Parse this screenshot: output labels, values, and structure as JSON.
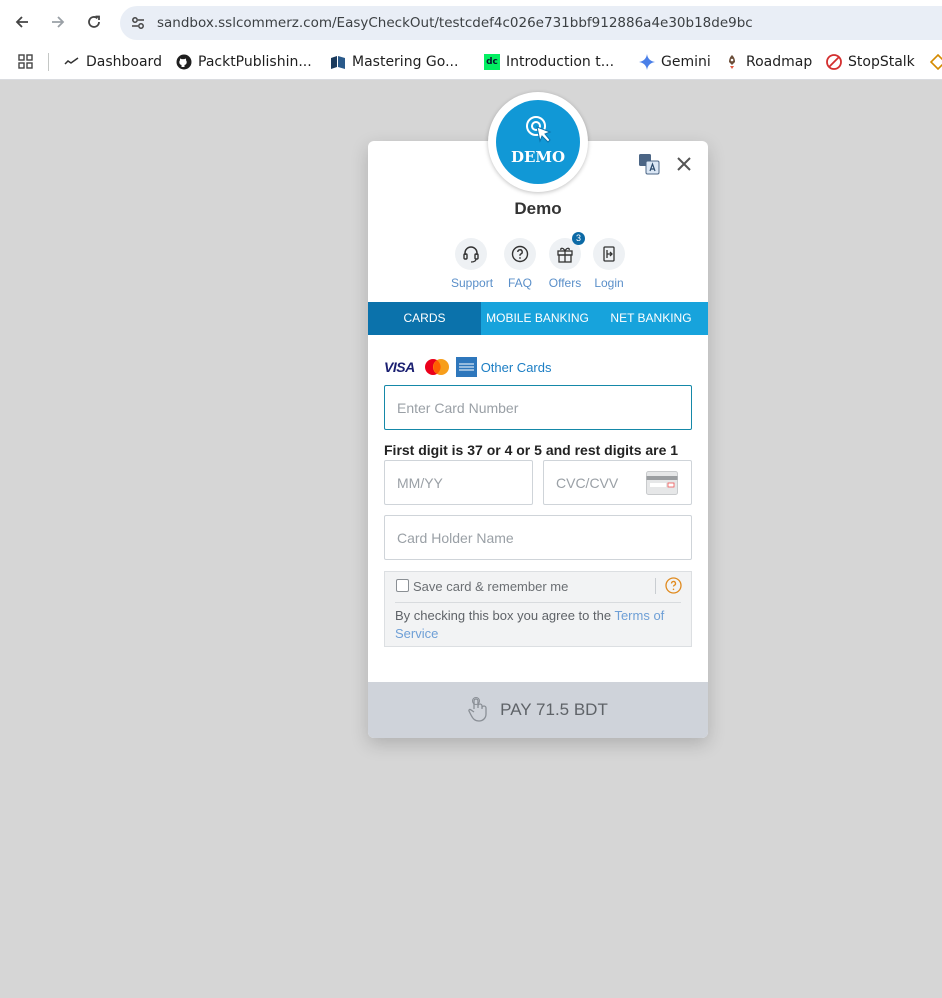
{
  "browser": {
    "url": "sandbox.sslcommerz.com/EasyCheckOut/testcdef4c026e731bbf912886a4e30b18de9bc",
    "bookmarks": [
      {
        "label": "Dashboard",
        "icon": "dashboard-icon"
      },
      {
        "label": "PacktPublishin...",
        "icon": "github-icon"
      },
      {
        "label": "Mastering Go...",
        "icon": "book-icon"
      },
      {
        "label": "Introduction t...",
        "icon": "dc-icon"
      },
      {
        "label": "Gemini",
        "icon": "gemini-icon"
      },
      {
        "label": "Roadmap",
        "icon": "rocket-icon"
      },
      {
        "label": "StopStalk",
        "icon": "stopstalk-icon"
      }
    ]
  },
  "checkout": {
    "logo_text": "DEMO",
    "merchant_name": "Demo",
    "quick_links": {
      "support": "Support",
      "faq": "FAQ",
      "offers": "Offers",
      "offers_count": "3",
      "login": "Login"
    },
    "tabs": [
      "CARDS",
      "MOBILE BANKING",
      "NET BANKING"
    ],
    "active_tab": "CARDS",
    "card_brands": {
      "visa": "VISA",
      "other": "Other Cards"
    },
    "card_number_placeholder": "Enter Card Number",
    "hint": "First digit is 37 or 4 or 5 and rest digits are 1",
    "expiry_placeholder": "MM/YY",
    "cvc_placeholder": "CVC/CVV",
    "holder_placeholder": "Card Holder Name",
    "save_card_label": "Save card & remember me",
    "terms_text": "By checking this box you agree to the ",
    "terms_link": "Terms of Service",
    "pay_label": "PAY 71.5 BDT"
  },
  "colors": {
    "tab_bar": "#17a3dc",
    "tab_active": "#0b72ab",
    "logo": "#1198d6",
    "pay_bar": "#cfd3da",
    "page_bg": "#d6d6d6"
  }
}
